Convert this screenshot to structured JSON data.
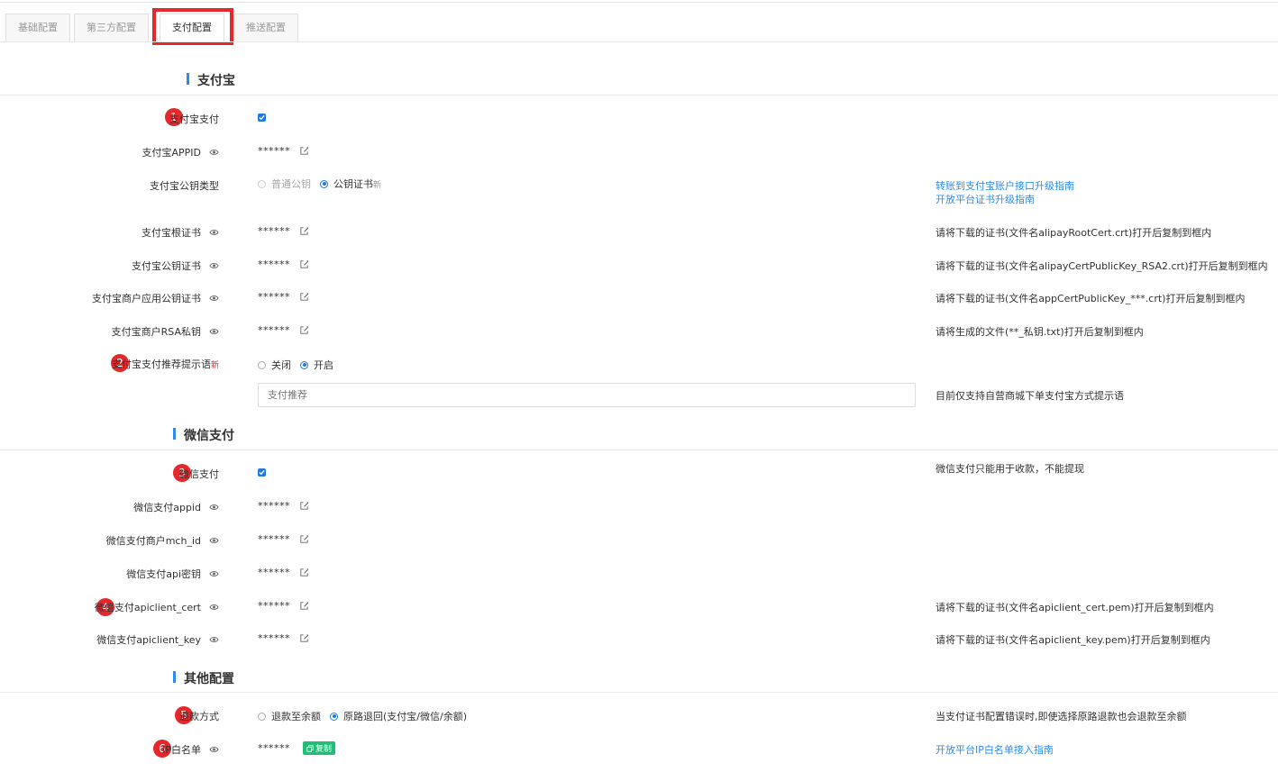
{
  "tabs": [
    "基础配置",
    "第三方配置",
    "支付配置",
    "推送配置"
  ],
  "sections": {
    "alipay": "支付宝",
    "wechat": "微信支付",
    "other": "其他配置"
  },
  "badges": [
    "1",
    "2",
    "3",
    "4",
    "5",
    "6"
  ],
  "mask": "******",
  "alipay": {
    "pay_label": "支付宝支付",
    "appid_label": "支付宝APPID",
    "key_type_label": "支付宝公钥类型",
    "key_type_options": [
      "普通公钥",
      "公钥证书"
    ],
    "new_mark": "新",
    "guide_link_1": "转账到支付宝账户接口升级指南",
    "guide_link_2": "开放平台证书升级指南",
    "root_cert_label": "支付宝根证书",
    "root_cert_hint": "请将下载的证书(文件名alipayRootCert.crt)打开后复制到框内",
    "pub_cert_label": "支付宝公钥证书",
    "pub_cert_hint": "请将下载的证书(文件名alipayCertPublicKey_RSA2.crt)打开后复制到框内",
    "app_cert_label": "支付宝商户应用公钥证书",
    "app_cert_hint": "请将下载的证书(文件名appCertPublicKey_***.crt)打开后复制到框内",
    "rsa_label": "支付宝商户RSA私钥",
    "rsa_hint": "请将生成的文件(**_私钥.txt)打开后复制到框内",
    "recommend_label": "支付宝支付推荐提示语",
    "recommend_options": [
      "关闭",
      "开启"
    ],
    "recommend_placeholder": "支付推荐",
    "recommend_hint": "目前仅支持自营商城下单支付宝方式提示语"
  },
  "wechat": {
    "pay_label": "微信支付",
    "pay_hint": "微信支付只能用于收款，不能提现",
    "appid_label": "微信支付appid",
    "mch_label": "微信支付商户mch_id",
    "api_key_label": "微信支付api密钥",
    "cert_label": "微信支付apiclient_cert",
    "cert_hint": "请将下载的证书(文件名apiclient_cert.pem)打开后复制到框内",
    "key_label": "微信支付apiclient_key",
    "key_hint": "请将下载的证书(文件名apiclient_key.pem)打开后复制到框内"
  },
  "other": {
    "refund_label": "退款方式",
    "refund_options": [
      "退款至余额",
      "原路退回(支付宝/微信/余额)"
    ],
    "refund_hint": "当支付证书配置错误时,即使选择原路退款也会退款至余额",
    "ip_label": "IP白名单",
    "copy_label": "复制",
    "ip_link": "开放平台IP白名单接入指南"
  },
  "colors": {
    "accent": "#2d8cf0",
    "badge": "#e5282b",
    "copy": "#1fbf75"
  }
}
